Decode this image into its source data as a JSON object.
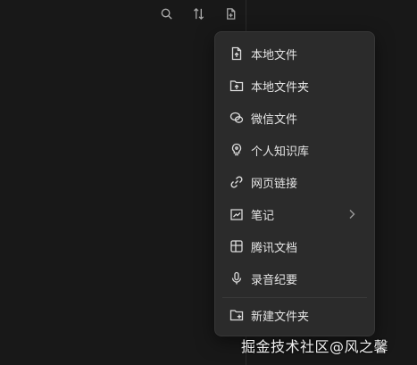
{
  "menu": {
    "items": [
      {
        "label": "本地文件",
        "icon": "file-upload-icon"
      },
      {
        "label": "本地文件夹",
        "icon": "folder-upload-icon"
      },
      {
        "label": "微信文件",
        "icon": "wechat-icon"
      },
      {
        "label": "个人知识库",
        "icon": "bulb-icon"
      },
      {
        "label": "网页链接",
        "icon": "link-icon"
      },
      {
        "label": "笔记",
        "icon": "note-icon",
        "has_submenu": true
      },
      {
        "label": "腾讯文档",
        "icon": "tencent-doc-icon"
      },
      {
        "label": "录音纪要",
        "icon": "mic-icon"
      },
      {
        "label": "新建文件夹",
        "icon": "new-folder-icon"
      }
    ]
  },
  "watermark": {
    "text": "掘金技术社区@风之馨"
  },
  "colors": {
    "background": "#181818",
    "menu_bg": "#2b2b2b",
    "text": "#e6e6e6"
  }
}
